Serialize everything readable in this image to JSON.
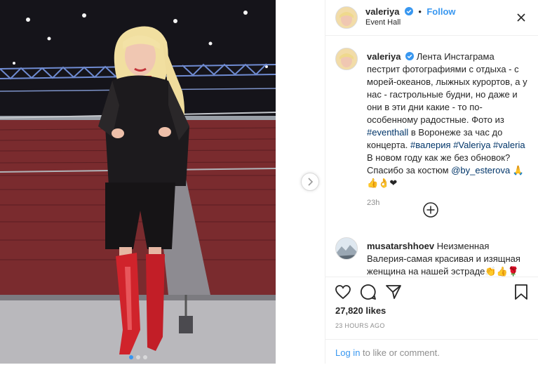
{
  "header": {
    "username": "valeriya",
    "follow_label": "Follow",
    "separator": "•",
    "location": "Event Hall"
  },
  "caption": {
    "username": "valeriya",
    "text_1": "Лента Инстаграма пестрит фотографиями с отдыха - с морей-океанов, лыжных курортов, а у нас - гастрольные будни, но даже и они в эти дни какие - то по-особенному радостные. Фото из ",
    "tag_1": "#eventhall",
    "text_2": " в Воронеже за час до концерта. ",
    "tag_2": "#валерия",
    "space_1": " ",
    "tag_3": "#Valeriya",
    "space_2": " ",
    "tag_4": "#valeria",
    "text_3": " В новом году как же без обновок? Спасибо за костюм ",
    "tag_5": "@by_esterova",
    "emoji": " 🙏👍👌❤",
    "time": "23h"
  },
  "comment": {
    "username": "musatarshhoev",
    "text": "Неизменная Валерия-самая красивая и изящная женщина на нашей эстраде👏👍🌹"
  },
  "actions": {
    "likes": "27,820 likes",
    "timestamp": "23 HOURS AGO",
    "login_link": "Log in",
    "login_rest": " to like or comment."
  },
  "photo": {
    "slides": 3,
    "active_slide": 1
  },
  "colors": {
    "accent": "#3897f0",
    "link": "#003569",
    "muted": "#8e8e8e",
    "border": "#efefef"
  },
  "icons": [
    "verified-icon",
    "more-options-icon",
    "add-comment-icon",
    "heart-icon",
    "comment-icon",
    "share-icon",
    "bookmark-icon",
    "next-arrow-icon"
  ]
}
